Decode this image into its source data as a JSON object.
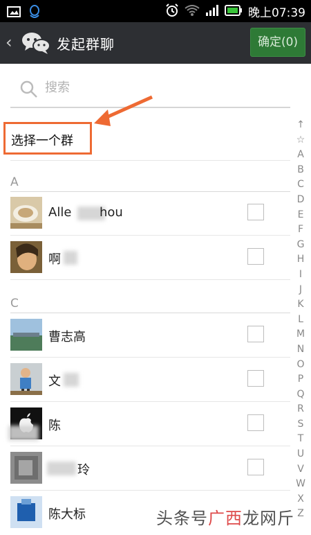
{
  "status_bar": {
    "time": "晚上07:39"
  },
  "header": {
    "back_icon": "chevron-left-icon",
    "title": "发起群聊",
    "confirm_label": "确定(0)"
  },
  "search": {
    "placeholder": "搜索"
  },
  "select_group": {
    "label": "选择一个群"
  },
  "sections": [
    {
      "letter": "A",
      "contacts": [
        {
          "name": "Alle",
          "name_tail": "hou"
        },
        {
          "name": "啊"
        }
      ]
    },
    {
      "letter": "C",
      "contacts": [
        {
          "name": "曹志高"
        },
        {
          "name": "文"
        },
        {
          "name": "陈"
        },
        {
          "name": "玲"
        },
        {
          "name": "陈大标"
        }
      ]
    }
  ],
  "index_bar": [
    "↑",
    "☆",
    "A",
    "B",
    "C",
    "D",
    "E",
    "F",
    "G",
    "H",
    "I",
    "J",
    "K",
    "L",
    "M",
    "N",
    "O",
    "P",
    "Q",
    "R",
    "S",
    "T",
    "U",
    "V",
    "W",
    "X",
    "Z"
  ],
  "watermark": {
    "part1": "头条号",
    "part2": "广西",
    "part3": "龙网",
    "part4": "斤"
  },
  "colors": {
    "titlebar": "#2d2f33",
    "confirm": "#2e7a36",
    "highlight": "#ee6a33"
  }
}
